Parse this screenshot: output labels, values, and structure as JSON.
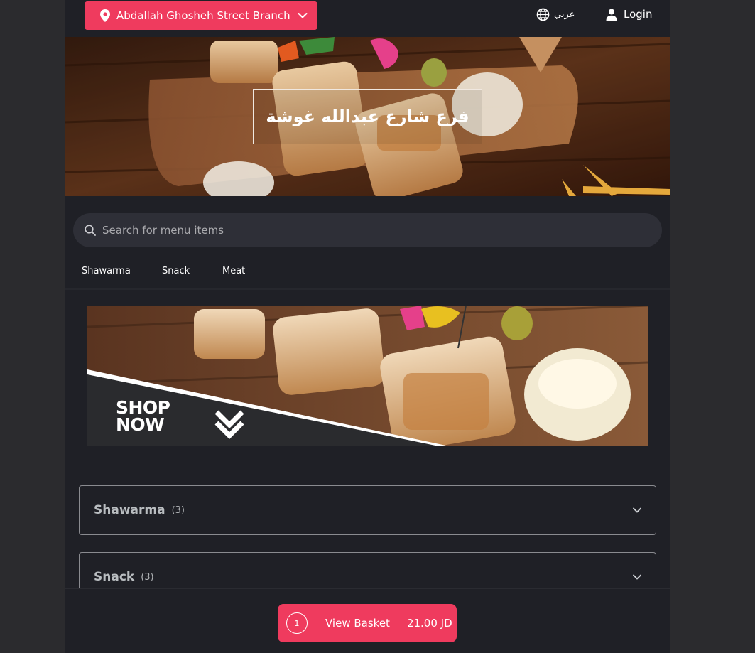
{
  "header": {
    "branch_label": "Abdallah Ghosheh Street Branch",
    "language_label": "عربي",
    "login_label": "Login"
  },
  "hero": {
    "title": "فرع شارع عبدالله غوشة"
  },
  "search": {
    "placeholder": "Search for menu items"
  },
  "tabs": [
    {
      "label": "Shawarma"
    },
    {
      "label": "Snack"
    },
    {
      "label": "Meat"
    }
  ],
  "banner": {
    "line1": "SHOP",
    "line2": "NOW"
  },
  "categories": [
    {
      "name": "Shawarma",
      "count": "(3)"
    },
    {
      "name": "Snack",
      "count": "(3)"
    }
  ],
  "basket": {
    "quantity": "1",
    "label": "View Basket",
    "total": "21.00 JD"
  },
  "colors": {
    "accent": "#ef3b5e",
    "background": "#1f2026",
    "outer": "#2b2b2e"
  },
  "icons": {
    "pin": "location-pin-icon",
    "chevron": "chevron-down-icon",
    "globe": "globe-icon",
    "user": "user-icon",
    "search": "search-icon",
    "arrows": "double-chevron-down-icon"
  }
}
